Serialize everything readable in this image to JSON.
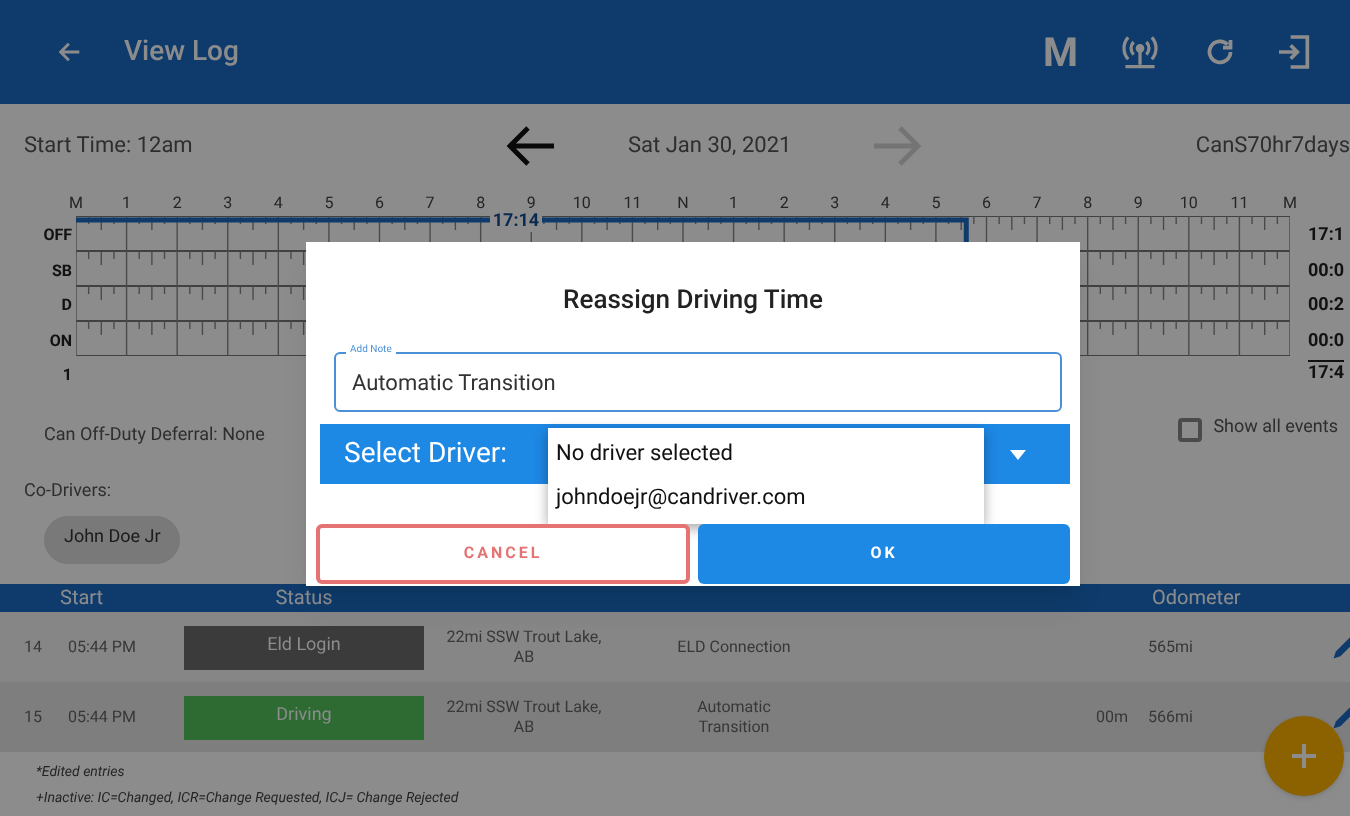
{
  "app_bar": {
    "title": "View Log",
    "mode_letter": "M"
  },
  "log_header": {
    "start_time": "Start Time: 12am",
    "date": "Sat Jan 30, 2021",
    "ruleset": "CanS70hr7days",
    "next_enabled": false
  },
  "graph": {
    "hour_labels": [
      "M",
      "1",
      "2",
      "3",
      "4",
      "5",
      "6",
      "7",
      "8",
      "9",
      "10",
      "11",
      "N",
      "1",
      "2",
      "3",
      "4",
      "5",
      "6",
      "7",
      "8",
      "9",
      "10",
      "11",
      "M"
    ],
    "rows": [
      {
        "label": "OFF",
        "total": "17:1"
      },
      {
        "label": "SB",
        "total": "00:0"
      },
      {
        "label": "D",
        "total": "00:2"
      },
      {
        "label": "ON",
        "total": "00:0"
      }
    ],
    "footer_label": "1",
    "grand_total": "17:4",
    "segment_label": "17:14"
  },
  "deferral": "Can Off-Duty Deferral: None",
  "show_all_events": {
    "label": "Show all events",
    "checked": false
  },
  "co_drivers_label": "Co-Drivers:",
  "co_drivers": [
    "John Doe Jr"
  ],
  "table": {
    "columns": [
      "Start",
      "Status",
      "Odometer"
    ],
    "rows": [
      {
        "index": "14",
        "start": "05:44 PM",
        "status": "Eld Login",
        "color": "#3b3b3b",
        "location": "22mi SSW Trout Lake, AB",
        "notes": "ELD Connection",
        "odometer": "565mi"
      },
      {
        "index": "15",
        "start": "05:44 PM",
        "status": "Driving",
        "color": "#2d6b33",
        "location": "22mi SSW Trout Lake, AB",
        "notes": "Automatic Transition",
        "duration": "00m",
        "odometer": "566mi"
      }
    ]
  },
  "legend": [
    "*Edited entries",
    "+Inactive: IC=Changed, ICR=Change Requested, ICJ= Change Rejected"
  ],
  "dialog": {
    "title": "Reassign Driving Time",
    "note": {
      "label": "Add Note",
      "value": "Automatic Transition"
    },
    "driver_select": {
      "label": "Select Driver:",
      "expanded": true,
      "options": [
        "No driver selected",
        "johndoejr@candriver.com"
      ]
    },
    "buttons": [
      {
        "kind": "cancel",
        "label": "CANCEL"
      },
      {
        "kind": "ok",
        "label": "OK"
      }
    ]
  }
}
